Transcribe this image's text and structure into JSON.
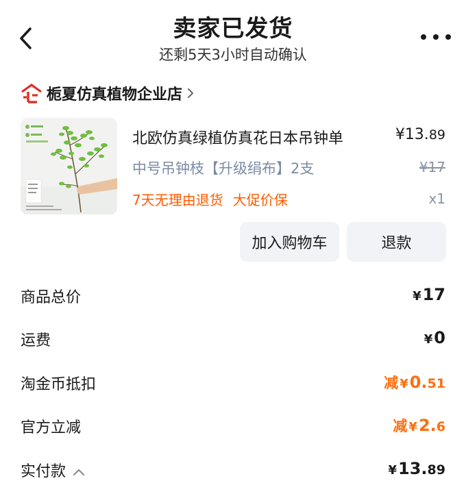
{
  "header": {
    "title": "卖家已发货",
    "subtitle": "还剩5天3小时自动确认"
  },
  "shop": {
    "name": "栀夏仿真植物企业店",
    "icon": "enterprise-shop-icon",
    "color": "#e02e24"
  },
  "product": {
    "title": "北欧仿真绿植仿真花日本吊钟单",
    "price_currency": "¥",
    "price_int": "13.",
    "price_dec": "89",
    "spec": "中号吊钟枝【升级绢布】2支",
    "original_price": "¥17",
    "tags": [
      "7天无理由退货",
      "大促价保"
    ],
    "quantity": "x1"
  },
  "buttons": {
    "add_cart": "加入购物车",
    "refund": "退款"
  },
  "summary": {
    "goods_total_label": "商品总价",
    "goods_total_currency": "¥",
    "goods_total_value": "17",
    "shipping_label": "运费",
    "shipping_currency": "¥",
    "shipping_value": "0",
    "coin_label": "淘金币抵扣",
    "coin_prefix": "减",
    "coin_currency": "¥",
    "coin_int": "0.",
    "coin_dec": "51",
    "official_label": "官方立减",
    "official_prefix": "减",
    "official_currency": "¥",
    "official_int": "2.",
    "official_dec": "6",
    "paid_label": "实付款",
    "paid_currency": "¥",
    "paid_int": "13.",
    "paid_dec": "89"
  },
  "colors": {
    "accent_orange": "#ff6d0d",
    "tag_orange": "#ff5a00",
    "spec_gray": "#7b8aa4",
    "button_bg": "#f1f3f6"
  }
}
